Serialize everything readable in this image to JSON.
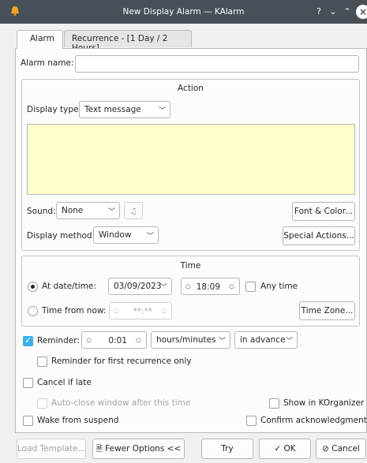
{
  "window": {
    "title": "New Display Alarm — KAlarm"
  },
  "tabs": [
    {
      "label": "Alarm"
    },
    {
      "label": "Recurrence - [1 Day / 2 Hours]"
    }
  ],
  "alarm_name": {
    "label": "Alarm name:",
    "value": ""
  },
  "action": {
    "title": "Action",
    "display_type_label": "Display type:",
    "display_type_value": "Text message",
    "message_text": "",
    "sound_label": "Sound:",
    "sound_value": "None",
    "font_color_button": "Font & Color...",
    "display_method_label": "Display method:",
    "display_method_value": "Window",
    "special_actions_button": "Special Actions..."
  },
  "time": {
    "title": "Time",
    "at_datetime_label": "At date/time:",
    "date_value": "03/09/2023",
    "time_value": "18:09",
    "any_time_label": "Any time",
    "time_from_now_label": "Time from now:",
    "time_from_now_value": "**:**",
    "time_zone_button": "Time Zone..."
  },
  "reminder": {
    "label": "Reminder:",
    "value": "0:01",
    "units": "hours/minutes",
    "when": "in advance",
    "first_recurrence_label": "Reminder for first recurrence only"
  },
  "options": {
    "cancel_if_late": "Cancel if late",
    "auto_close": "Auto-close window after this time",
    "show_in_korganizer": "Show in KOrganizer",
    "wake_from_suspend": "Wake from suspend",
    "confirm_ack": "Confirm acknowledgment"
  },
  "buttons": {
    "load_template": "Load Template...",
    "fewer_options": "Fewer Options <<",
    "try": "Try",
    "ok": "OK",
    "cancel": "Cancel"
  },
  "colors": {
    "accent": "#3daee9",
    "titlebar": "#475057",
    "message_bg": "#ffffcc"
  }
}
